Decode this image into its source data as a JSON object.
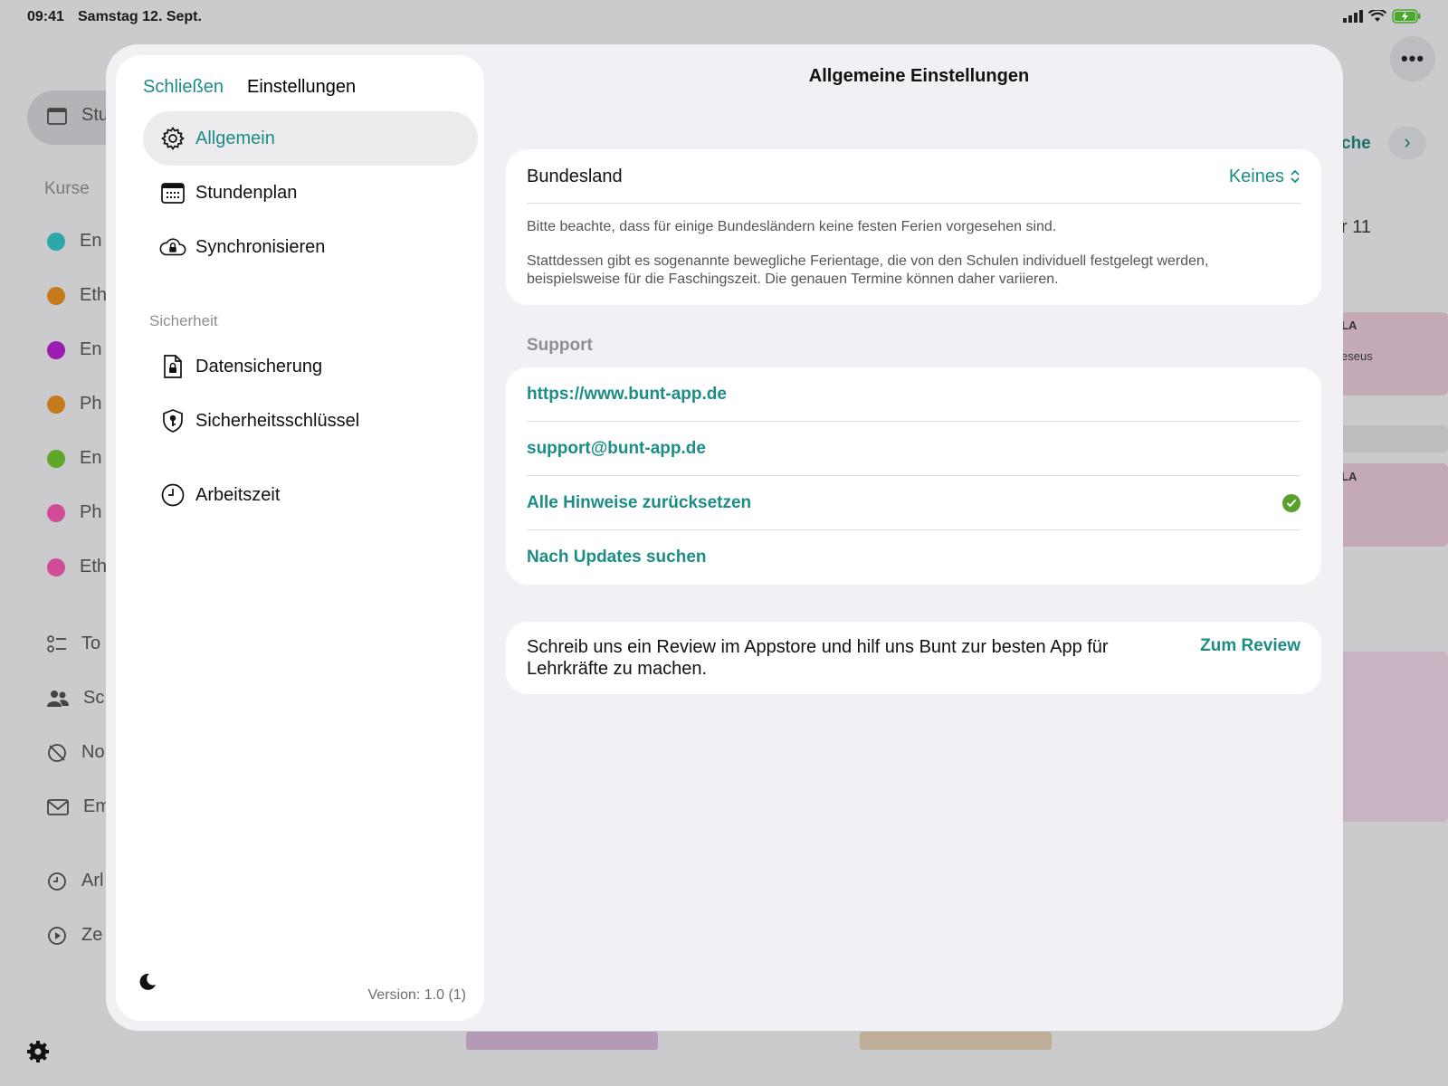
{
  "status_bar": {
    "time": "09:41",
    "date": "Samstag 12. Sept."
  },
  "background": {
    "sidebar_active_label": "Stu",
    "kurse_label": "Kurse",
    "courses": [
      {
        "label": "En",
        "color": "#2ea7a8"
      },
      {
        "label": "Eth",
        "color": "#c57a1c"
      },
      {
        "label": "En",
        "color": "#9a1cb0"
      },
      {
        "label": "Ph",
        "color": "#c57a1c"
      },
      {
        "label": "En",
        "color": "#5ea72a"
      },
      {
        "label": "Ph",
        "color": "#d04c96"
      },
      {
        "label": "Eth",
        "color": "#d04c96"
      }
    ],
    "tools": [
      {
        "label": "To",
        "icon": "checklist-icon"
      },
      {
        "label": "Sc",
        "icon": "people-icon"
      },
      {
        "label": "No",
        "icon": "no-clock-icon"
      },
      {
        "label": "Em",
        "icon": "mail-icon"
      }
    ],
    "extras": [
      {
        "label": "Arl",
        "icon": "clock-icon"
      },
      {
        "label": "Ze",
        "icon": "play-icon"
      }
    ],
    "week_label": "che",
    "day_label": "r 11",
    "event1_label": "LA",
    "event1_sub": "eseus",
    "event2_label": "LA"
  },
  "sheet": {
    "close_label": "Schließen",
    "sidebar_title": "Einstellungen",
    "nav": [
      {
        "label": "Allgemein",
        "icon": "gear-icon",
        "active": true
      },
      {
        "label": "Stundenplan",
        "icon": "calendar-icon"
      },
      {
        "label": "Synchronisieren",
        "icon": "cloud-lock-icon"
      }
    ],
    "security_label": "Sicherheit",
    "security_nav": [
      {
        "label": "Datensicherung",
        "icon": "doc-lock-icon"
      },
      {
        "label": "Sicherheitsschlüssel",
        "icon": "shield-key-icon"
      }
    ],
    "work_nav": {
      "label": "Arbeitszeit",
      "icon": "clock-icon"
    },
    "version": "Version: 1.0 (1)",
    "detail_title": "Allgemeine Einstellungen",
    "bundesland": {
      "label": "Bundesland",
      "value": "Keines",
      "note1": "Bitte beachte, dass für einige Bundesländern keine festen Ferien vorgesehen sind.",
      "note2": "Stattdessen gibt es sogenannte bewegliche Ferientage, die von den Schulen individuell festgelegt werden, beispielsweise für die Faschingszeit. Die genauen Termine können daher variieren."
    },
    "support": {
      "header": "Support",
      "website": "https://www.bunt-app.de",
      "email": "support@bunt-app.de",
      "reset_hints": "Alle Hinweise zurücksetzen",
      "check_updates": "Nach Updates suchen"
    },
    "review": {
      "text": "Schreib uns ein Review im Appstore und hilf uns Bunt zur besten App für Lehrkräfte zu machen.",
      "button": "Zum Review"
    }
  },
  "colors": {
    "accent": "#1c8d86",
    "check": "#5aa02c"
  }
}
